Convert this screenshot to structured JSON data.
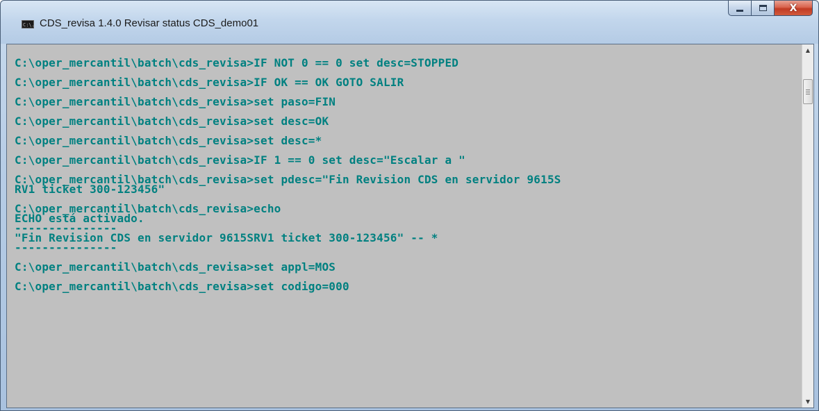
{
  "window": {
    "title": "CDS_revisa 1.4.0 Revisar status CDS_demo01",
    "icon": "cmd-icon",
    "icon_text": "C:\\."
  },
  "caption_buttons": {
    "minimize_icon": "minimize-icon",
    "maximize_icon": "maximize-icon",
    "close_icon": "close-icon",
    "close_glyph": "X"
  },
  "console": {
    "text_color": "#008080",
    "background_color": "#c0c0c0",
    "lines": [
      "C:\\oper_mercantil\\batch\\cds_revisa>IF NOT 0 == 0 set desc=STOPPED",
      "",
      "C:\\oper_mercantil\\batch\\cds_revisa>IF OK == OK GOTO SALIR",
      "",
      "C:\\oper_mercantil\\batch\\cds_revisa>set paso=FIN",
      "",
      "C:\\oper_mercantil\\batch\\cds_revisa>set desc=OK",
      "",
      "C:\\oper_mercantil\\batch\\cds_revisa>set desc=*",
      "",
      "C:\\oper_mercantil\\batch\\cds_revisa>IF 1 == 0 set desc=\"Escalar a \"",
      "",
      "C:\\oper_mercantil\\batch\\cds_revisa>set pdesc=\"Fin Revision CDS en servidor 9615S",
      "RV1 ticket 300-123456\"",
      "",
      "C:\\oper_mercantil\\batch\\cds_revisa>echo",
      "ECHO está activado.",
      "---------------",
      "\"Fin Revision CDS en servidor 9615SRV1 ticket 300-123456\" -- *",
      "---------------",
      "",
      "C:\\oper_mercantil\\batch\\cds_revisa>set appl=MOS",
      "",
      "C:\\oper_mercantil\\batch\\cds_revisa>set codigo=000"
    ]
  },
  "scrollbar": {
    "up_icon": "scroll-up-arrow-icon",
    "down_icon": "scroll-down-arrow-icon",
    "up_glyph": "▲",
    "down_glyph": "▼"
  }
}
